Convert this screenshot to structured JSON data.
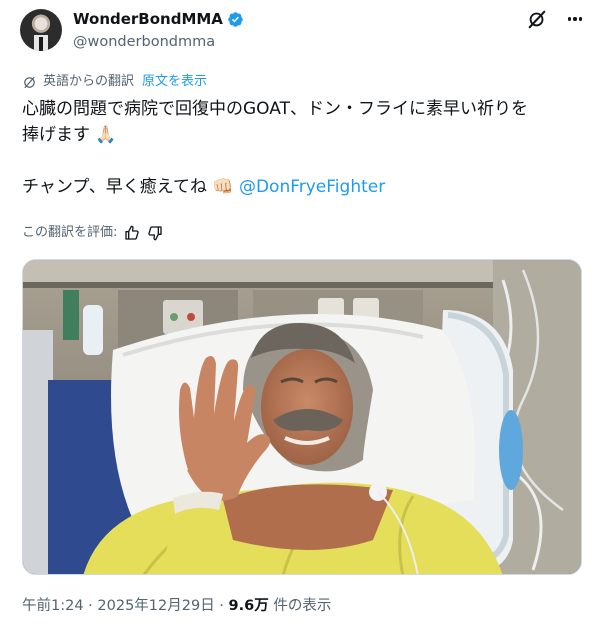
{
  "author": {
    "display_name": "WonderBondMMA",
    "handle": "@wonderbondmma"
  },
  "translation": {
    "label": "英語からの翻訳",
    "original_link": "原文を表示"
  },
  "tweet": {
    "line1": "心臓の問題で病院で回復中のGOAT、ドン・フライに素早い祈りを",
    "line2": "捧げます",
    "line2_emoji": "🙏🏻",
    "line3": "チャンプ、早く癒えてね",
    "line3_emoji": "👊🏻",
    "mention": "@DonFryeFighter"
  },
  "rating": {
    "label": "この翻訳を評価:"
  },
  "footer": {
    "time": "午前1:24",
    "sep1": " · ",
    "date": "2025年12月29日",
    "sep2": " · ",
    "views": "9.6万",
    "views_suffix": " 件の表示"
  },
  "colors": {
    "link": "#1d9bf0",
    "secondary_text": "#536471",
    "primary_text": "#0f1419"
  },
  "icons": [
    "verified-badge-icon",
    "grok-icon",
    "more-icon",
    "translate-icon",
    "thumbs-up-icon",
    "thumbs-down-icon"
  ]
}
